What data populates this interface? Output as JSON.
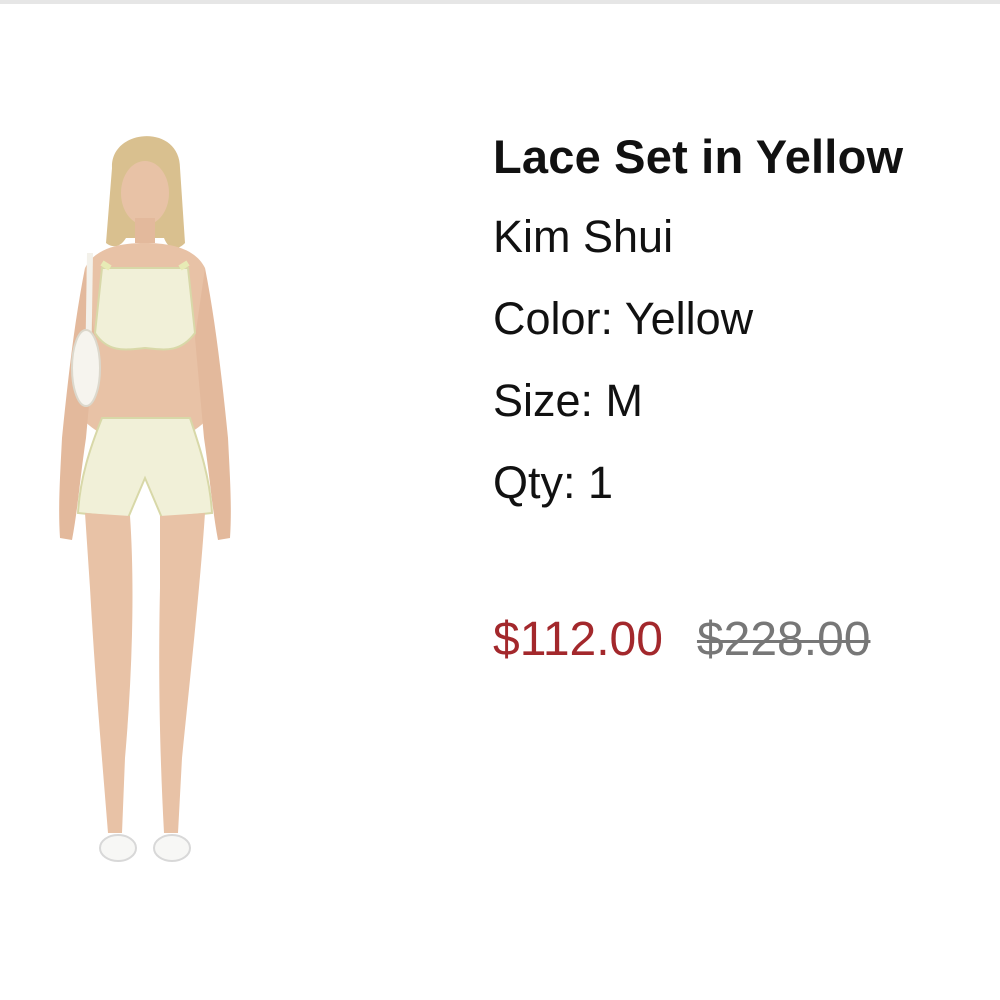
{
  "product": {
    "title": "Lace Set in Yellow",
    "brand": "Kim Shui",
    "color_line": "Color: Yellow",
    "size_line": "Size: M",
    "qty_line": "Qty: 1",
    "sale_price": "$112.00",
    "original_price": "$228.00"
  },
  "colors": {
    "sale_price": "#a3282c",
    "original_price": "#777777",
    "garment": "#f1f0d8"
  }
}
